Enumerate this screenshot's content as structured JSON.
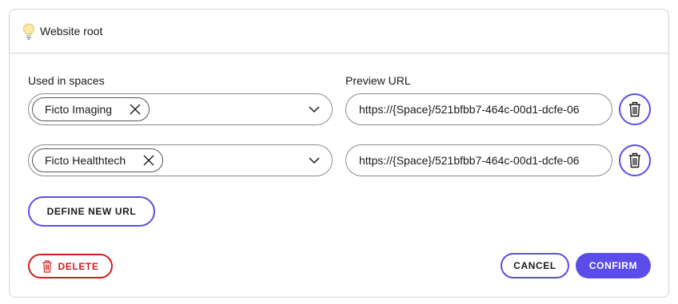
{
  "header": {
    "icon": "lightbulb-icon",
    "title": "Website root"
  },
  "form": {
    "spaces_label": "Used in spaces",
    "url_label": "Preview URL",
    "rows": [
      {
        "space": "Ficto Imaging",
        "url": "https://{Space}/521bfbb7-464c-00d1-dcfe-06"
      },
      {
        "space": "Ficto Healthtech",
        "url": "https://{Space}/521bfbb7-464c-00d1-dcfe-06"
      }
    ],
    "define_new_url": "DEFINE NEW URL"
  },
  "footer": {
    "delete_label": "DELETE",
    "cancel_label": "CANCEL",
    "confirm_label": "CONFIRM"
  },
  "colors": {
    "accent": "#5b4ee8",
    "danger": "#d0201c",
    "border": "#d6d6d6"
  }
}
